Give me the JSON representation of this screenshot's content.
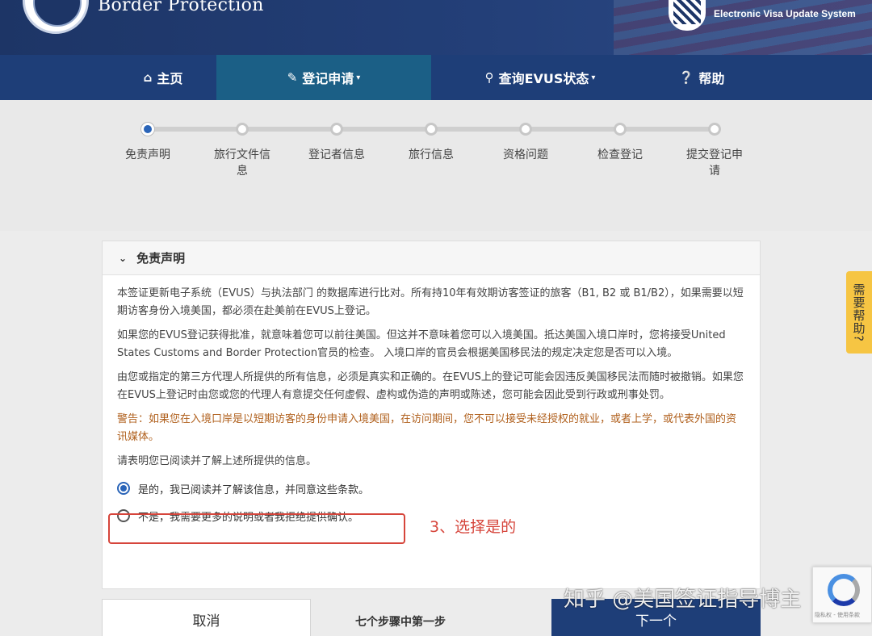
{
  "header": {
    "agency_text": "Border Protection",
    "system_name": "Electronic Visa Update System"
  },
  "nav": [
    {
      "label": "主页",
      "icon": "home-icon"
    },
    {
      "label": "登记申请",
      "icon": "pencil-icon"
    },
    {
      "label": "查询EVUS状态",
      "icon": "search-icon"
    },
    {
      "label": "帮助",
      "icon": "question-icon"
    }
  ],
  "steps": [
    "免责声明",
    "旅行文件信息",
    "登记者信息",
    "旅行信息",
    "资格问题",
    "检查登记",
    "提交登记申请"
  ],
  "current_step": 1,
  "panel": {
    "title": "免责声明",
    "paragraphs": [
      "本签证更新电子系统（EVUS）与执法部门 的数据库进行比对。所有持10年有效期访客签证的旅客（B1, B2 或 B1/B2），如果需要以短期访客身份入境美国，都必须在赴美前在EVUS上登记。",
      "如果您的EVUS登记获得批准，就意味着您可以前往美国。但这并不意味着您可以入境美国。抵达美国入境口岸时，您将接受United States Customs and Border Protection官员的检查。 入境口岸的官员会根据美国移民法的规定决定您是否可以入境。",
      "由您或指定的第三方代理人所提供的所有信息，必须是真实和正确的。在EVUS上的登记可能会因违反美国移民法而随时被撤销。如果您在EVUS上登记时由您或您的代理人有意提交任何虚假、虚构或伪造的声明或陈述，您可能会因此受到行政或刑事处罚。"
    ],
    "warning": "警告：如果您在入境口岸是以短期访客的身份申请入境美国，在访问期间，您不可以接受未经授权的就业，或者上学，或代表外国的资讯媒体。",
    "prompt": "请表明您已阅读并了解上述所提供的信息。",
    "option_yes": "是的，我已阅读并了解该信息，并同意这些条款。",
    "option_no": "不是，我需要更多的说明或者我拒绝提供确认。",
    "selected": "yes"
  },
  "annotation": "3、选择是的",
  "footer": {
    "cancel_label": "取消",
    "step_count": "七个步骤中第一步",
    "next_label": "下一个"
  },
  "help_tab": "需要帮助?",
  "recaptcha_text": "隐私权 - 使用条款",
  "watermark": "知乎 @美国签证指导博主",
  "colors": {
    "nav_bg": "#1e3e78",
    "nav_active": "#1b5f86",
    "accent": "#2a64b8",
    "warning_text": "#b0601d",
    "annotation_red": "#d6453b",
    "help_tab": "#f6c543"
  }
}
